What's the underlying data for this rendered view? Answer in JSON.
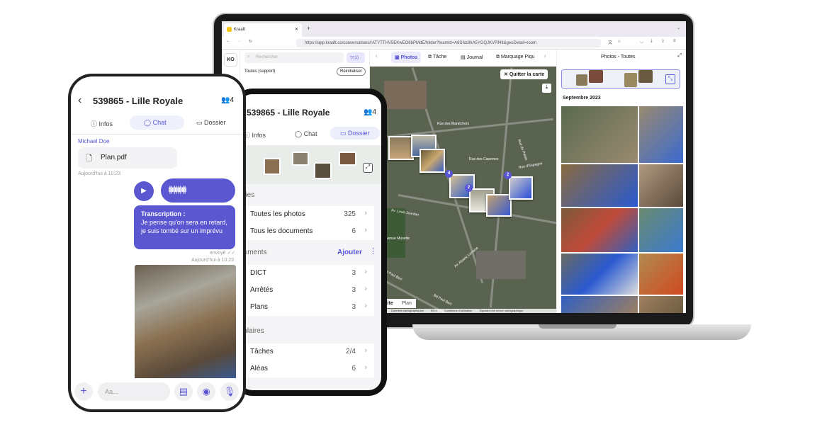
{
  "browser": {
    "tab_title": "Kraaft",
    "url_domain": "https://app.kraaft.co",
    "url": "https://app.kraaft.co/conversations/rATYTTHV5EKwEO6bPMdE/folder?teamId=A8SNz8hA5YGQJKVRf4Il&geoDetail=room"
  },
  "desktop": {
    "avatar": "KO",
    "search_placeholder": "Rechercher",
    "filter_label": "(1)",
    "filter_scope": "Toutes (support)",
    "reset_label": "Réinitialiser",
    "tabs": [
      {
        "label": "Photos",
        "active": true
      },
      {
        "label": "Tâche"
      },
      {
        "label": "Journal"
      },
      {
        "label": "Marquage Piqu"
      }
    ],
    "map": {
      "quit_label": "Quitter la carte",
      "cluster_badges": [
        "4",
        "2",
        "2"
      ],
      "streets": [
        "Rue des Maraîchers",
        "Rue des Casernes",
        "Rue du Palais",
        "Rue d'Espagne",
        "Av. Louis Jourdan",
        "Avenue Musette",
        "Bd Paul Bert",
        "Bd Paul Bert",
        "Av. Alsace Lorraine"
      ],
      "view_modes": [
        "Satellite",
        "Plan"
      ],
      "footer": [
        "Données cartographiques",
        "50 m",
        "Conditions d'utilisation",
        "Signaler une erreur cartographique"
      ]
    },
    "right_panel": {
      "title": "Photos - Toutes",
      "month": "Septembre 2023"
    }
  },
  "tablet": {
    "title": "539865 - Lille Royale",
    "members": "4",
    "tabs": [
      {
        "label": "Infos"
      },
      {
        "label": "Chat"
      },
      {
        "label": "Dossier",
        "active": true
      }
    ],
    "sections": [
      {
        "title": "Galeries",
        "rows": [
          {
            "label": "Toutes les photos",
            "count": "325"
          },
          {
            "label": "Tous les documents",
            "count": "6"
          }
        ]
      },
      {
        "title": "Documents",
        "action": "Ajouter",
        "rows": [
          {
            "label": "DICT",
            "count": "3"
          },
          {
            "label": "Arrêtés",
            "count": "3"
          },
          {
            "label": "Plans",
            "count": "3"
          }
        ]
      },
      {
        "title": "Formulaires",
        "rows": [
          {
            "label": "Tâches",
            "count": "2/4"
          },
          {
            "label": "Aléas",
            "count": "6"
          }
        ]
      }
    ]
  },
  "phone": {
    "title": "539865 - Lille Royale",
    "members": "4",
    "tabs": [
      {
        "label": "Infos"
      },
      {
        "label": "Chat",
        "active": true
      },
      {
        "label": "Dossier"
      }
    ],
    "sender": "Michael Doe",
    "file": "Plan.pdf",
    "time1": "Aujourd'hui à 10:23",
    "transcription_title": "Transcription :",
    "transcription": "Je pense qu'on sera en retard, je suis tombé sur un imprévu",
    "status": "envoyé",
    "time2": "Aujourd'hui à 10:23",
    "input_placeholder": "Aa..."
  },
  "colors": {
    "accent": "#5856d6",
    "bubble": "#5b57d0"
  }
}
